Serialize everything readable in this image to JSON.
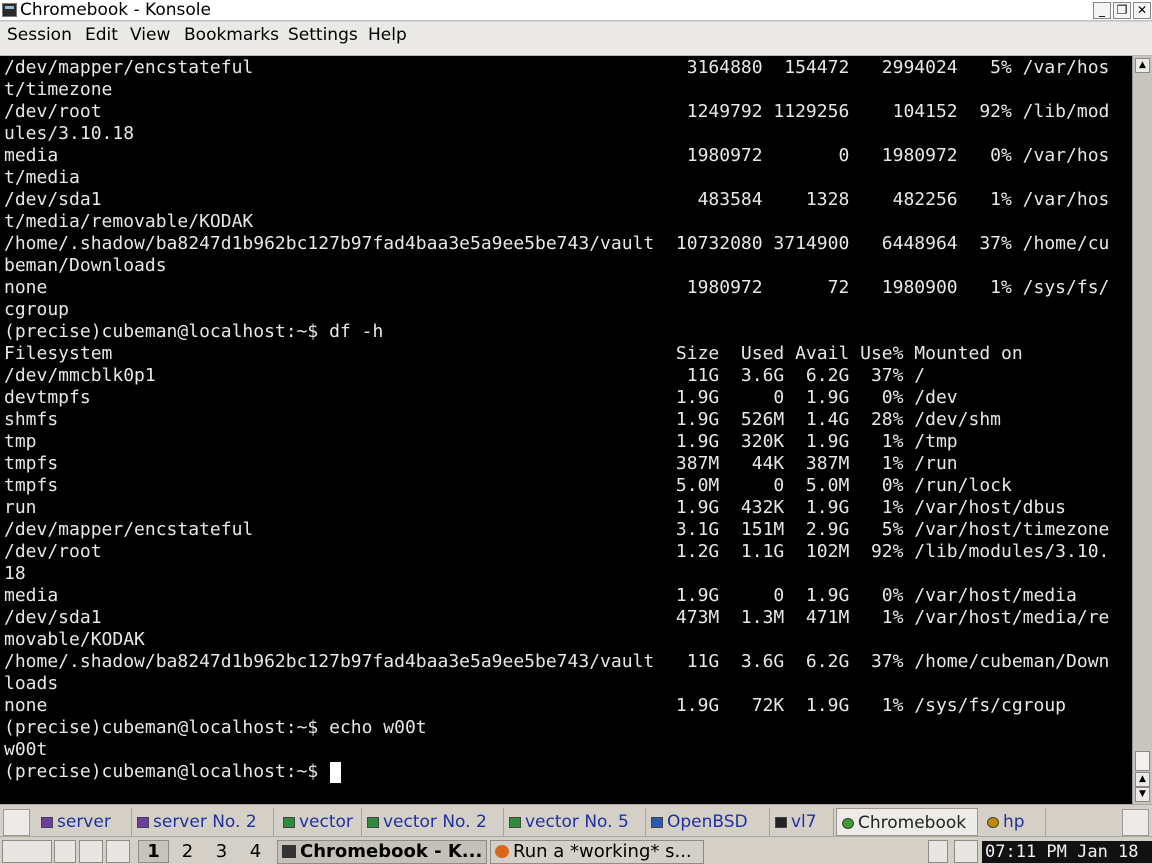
{
  "window": {
    "title": "Chromebook - Konsole",
    "buttons": {
      "minimize": "_",
      "maximize": "❐",
      "close": "✕"
    }
  },
  "menubar": {
    "items": [
      "Session",
      "Edit",
      "View",
      "Bookmarks",
      "Settings",
      "Help"
    ]
  },
  "terminal": {
    "lines": [
      "/dev/mapper/encstateful                                        3164880  154472   2994024   5% /var/hos",
      "t/timezone",
      "/dev/root                                                      1249792 1129256    104152  92% /lib/mod",
      "ules/3.10.18",
      "media                                                          1980972       0   1980972   0% /var/hos",
      "t/media",
      "/dev/sda1                                                       483584    1328    482256   1% /var/hos",
      "t/media/removable/KODAK",
      "/home/.shadow/ba8247d1b962bc127b97fad4baa3e5a9ee5be743/vault  10732080 3714900   6448964  37% /home/cu",
      "beman/Downloads",
      "none                                                           1980972      72   1980900   1% /sys/fs/",
      "cgroup",
      "(precise)cubeman@localhost:~$ df -h",
      "Filesystem                                                    Size  Used Avail Use% Mounted on",
      "/dev/mmcblk0p1                                                 11G  3.6G  6.2G  37% /",
      "devtmpfs                                                      1.9G     0  1.9G   0% /dev",
      "shmfs                                                         1.9G  526M  1.4G  28% /dev/shm",
      "tmp                                                           1.9G  320K  1.9G   1% /tmp",
      "tmpfs                                                         387M   44K  387M   1% /run",
      "tmpfs                                                         5.0M     0  5.0M   0% /run/lock",
      "run                                                           1.9G  432K  1.9G   1% /var/host/dbus",
      "/dev/mapper/encstateful                                       3.1G  151M  2.9G   5% /var/host/timezone",
      "/dev/root                                                     1.2G  1.1G  102M  92% /lib/modules/3.10.",
      "18",
      "media                                                         1.9G     0  1.9G   0% /var/host/media",
      "/dev/sda1                                                     473M  1.3M  471M   1% /var/host/media/re",
      "movable/KODAK",
      "/home/.shadow/ba8247d1b962bc127b97fad4baa3e5a9ee5be743/vault   11G  3.6G  6.2G  37% /home/cubeman/Down",
      "loads",
      "none                                                          1.9G   72K  1.9G   1% /sys/fs/cgroup",
      "(precise)cubeman@localhost:~$ echo w00t",
      "w00t",
      "(precise)cubeman@localhost:~$ "
    ]
  },
  "taskbar": {
    "tabs": [
      {
        "label": "server",
        "icon": "terminal-icon",
        "icon_color": "#6a3fa0",
        "active": false
      },
      {
        "label": "server No. 2",
        "icon": "terminal-icon",
        "icon_color": "#6a3fa0",
        "active": false
      },
      {
        "label": "vector",
        "icon": "terminal-icon",
        "icon_color": "#2e8b3e",
        "active": false
      },
      {
        "label": "vector No. 2",
        "icon": "terminal-icon",
        "icon_color": "#2e8b3e",
        "active": false
      },
      {
        "label": "vector No. 5",
        "icon": "terminal-icon",
        "icon_color": "#2e8b3e",
        "active": false
      },
      {
        "label": "OpenBSD",
        "icon": "terminal-icon",
        "icon_color": "#2a5bb0",
        "active": false
      },
      {
        "label": "vl7",
        "icon": "tux-icon",
        "icon_color": "#222222",
        "active": false
      },
      {
        "label": "Chromebook",
        "icon": "gear-icon",
        "icon_color": "#3b9b2e",
        "active": true
      },
      {
        "label": "hp",
        "icon": "hp-icon",
        "icon_color": "#c08a00",
        "active": false
      }
    ],
    "desktops": [
      "1",
      "2",
      "3",
      "4"
    ],
    "active_desktop": "1",
    "tasks": [
      {
        "label": "Chromebook - K...",
        "icon": "terminal-icon",
        "active": true
      },
      {
        "label": "Run a *working* s...",
        "icon": "firefox-icon",
        "active": false
      }
    ],
    "clock": "07:11 PM Jan 18"
  },
  "colors": {
    "terminal_bg": "#000000",
    "terminal_fg": "#e8e8e8",
    "link_blue": "#2130a0",
    "panel_bg": "#d4d0c8"
  }
}
